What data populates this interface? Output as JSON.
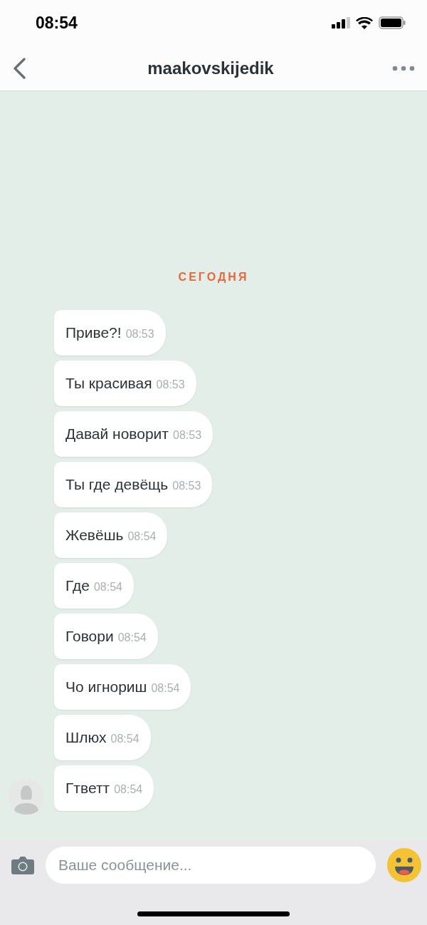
{
  "status_bar": {
    "time": "08:54"
  },
  "header": {
    "title": "maakovskijedik"
  },
  "date_label": "СЕГОДНЯ",
  "messages": [
    {
      "text": "Приве?!",
      "time": "08:53"
    },
    {
      "text": "Ты красивая",
      "time": "08:53"
    },
    {
      "text": "Давай новорит",
      "time": "08:53"
    },
    {
      "text": "Ты где девёщь",
      "time": "08:53"
    },
    {
      "text": "Жевёшь",
      "time": "08:54"
    },
    {
      "text": "Где",
      "time": "08:54"
    },
    {
      "text": "Говори",
      "time": "08:54"
    },
    {
      "text": "Чо игнориш",
      "time": "08:54"
    },
    {
      "text": "Шлюх",
      "time": "08:54"
    },
    {
      "text": "Гтветт",
      "time": "08:54"
    }
  ],
  "composer": {
    "placeholder": "Ваше сообщение..."
  }
}
